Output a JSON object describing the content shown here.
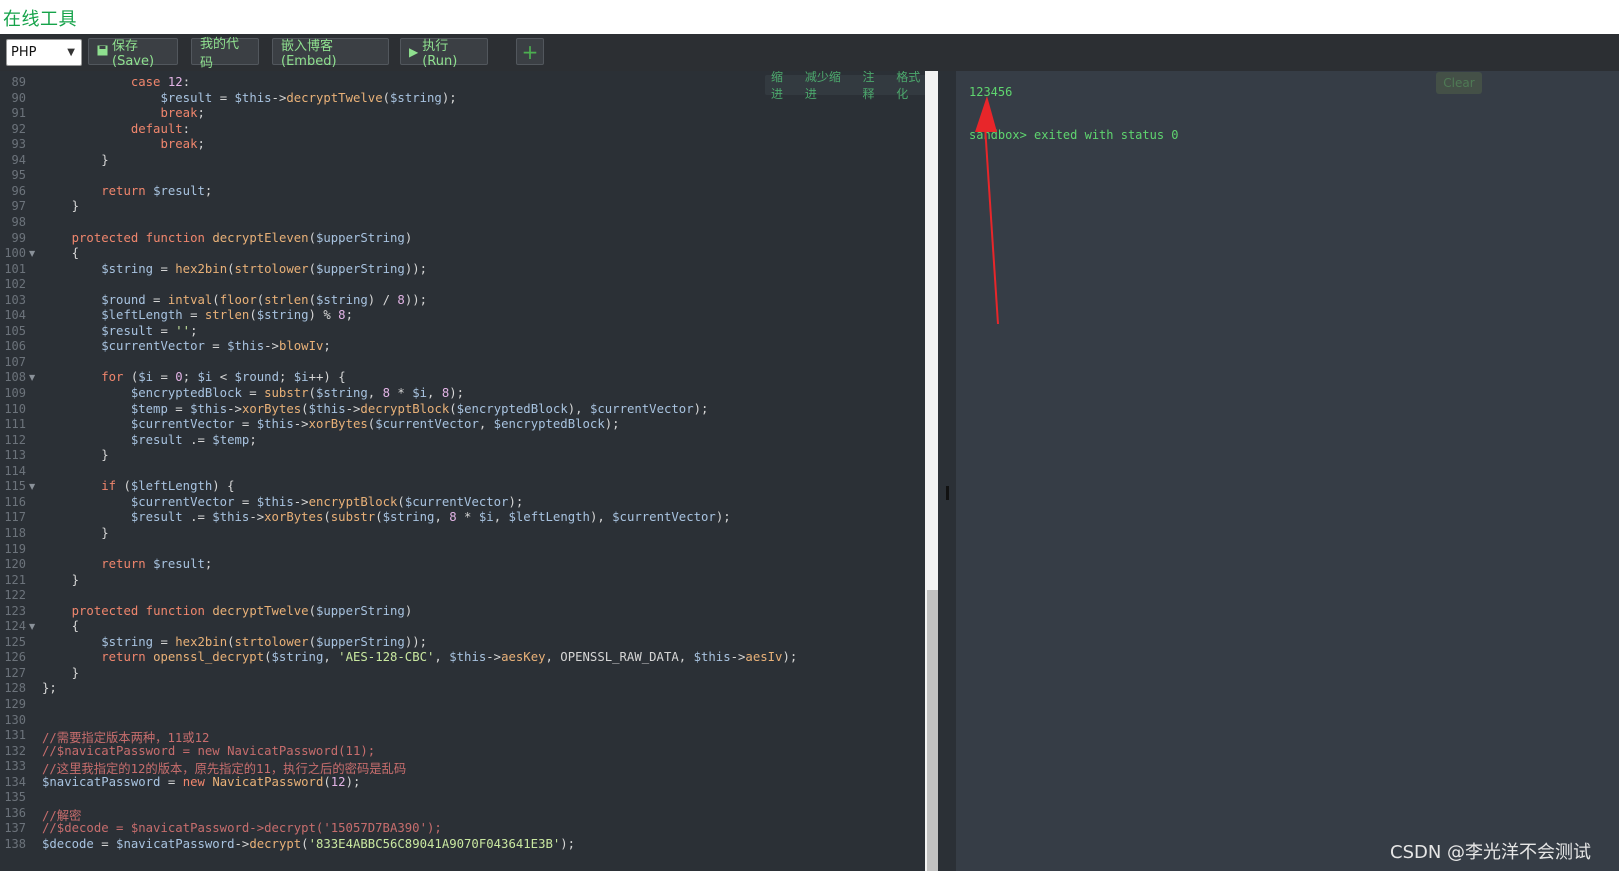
{
  "app": {
    "title": "在线工具"
  },
  "toolbar": {
    "language": "PHP",
    "save_label": "保存(Save)",
    "mycode_label": "我的代码",
    "embed_label": "嵌入博客(Embed)",
    "run_label": "执行(Run)",
    "add_label": "+"
  },
  "editor_actions": {
    "indent": "缩进",
    "outdent": "减少缩进",
    "comment": "注释",
    "format": "格式化"
  },
  "editor": {
    "line_numbers": [
      "89",
      "90",
      "91",
      "92",
      "93",
      "94",
      "95",
      "96",
      "97",
      "98",
      "99",
      "100",
      "101",
      "102",
      "103",
      "104",
      "105",
      "106",
      "107",
      "108",
      "109",
      "110",
      "111",
      "112",
      "113",
      "114",
      "115",
      "116",
      "117",
      "118",
      "119",
      "120",
      "121",
      "122",
      "123",
      "124",
      "125",
      "126",
      "127",
      "128",
      "129",
      "130",
      "131",
      "132",
      "133",
      "134",
      "135",
      "136",
      "137",
      "138"
    ],
    "fold_lines": [
      "100",
      "108",
      "115",
      "124"
    ],
    "lines": [
      "            case 12:",
      "                $result = $this->decryptTwelve($string);",
      "                break;",
      "            default:",
      "                break;",
      "        }",
      "",
      "        return $result;",
      "    }",
      "",
      "    protected function decryptEleven($upperString)",
      "    {",
      "        $string = hex2bin(strtolower($upperString));",
      "",
      "        $round = intval(floor(strlen($string) / 8));",
      "        $leftLength = strlen($string) % 8;",
      "        $result = '';",
      "        $currentVector = $this->blowIv;",
      "",
      "        for ($i = 0; $i < $round; $i++) {",
      "            $encryptedBlock = substr($string, 8 * $i, 8);",
      "            $temp = $this->xorBytes($this->decryptBlock($encryptedBlock), $currentVector);",
      "            $currentVector = $this->xorBytes($currentVector, $encryptedBlock);",
      "            $result .= $temp;",
      "        }",
      "",
      "        if ($leftLength) {",
      "            $currentVector = $this->encryptBlock($currentVector);",
      "            $result .= $this->xorBytes(substr($string, 8 * $i, $leftLength), $currentVector);",
      "        }",
      "",
      "        return $result;",
      "    }",
      "",
      "    protected function decryptTwelve($upperString)",
      "    {",
      "        $string = hex2bin(strtolower($upperString));",
      "        return openssl_decrypt($string, 'AES-128-CBC', $this->aesKey, OPENSSL_RAW_DATA, $this->aesIv);",
      "    }",
      "};",
      "",
      "",
      "//需要指定版本两种，11或12",
      "//$navicatPassword = new NavicatPassword(11);",
      "//这里我指定的12的版本，原先指定的11，执行之后的密码是乱码",
      "$navicatPassword = new NavicatPassword(12);",
      "",
      "//解密",
      "//$decode = $navicatPassword->decrypt('15057D7BA390');",
      "$decode = $navicatPassword->decrypt('833E4ABBC56C89041A9070F043641E3B');"
    ]
  },
  "output": {
    "line1": "123456",
    "line2": "sandbox> exited with status 0",
    "clear_label": "Clear"
  },
  "watermark": "CSDN @李光洋不会测试",
  "colors": {
    "brand": "#16a34a",
    "annotation_arrow": "#e8262a",
    "output_text": "#5fd56f"
  }
}
